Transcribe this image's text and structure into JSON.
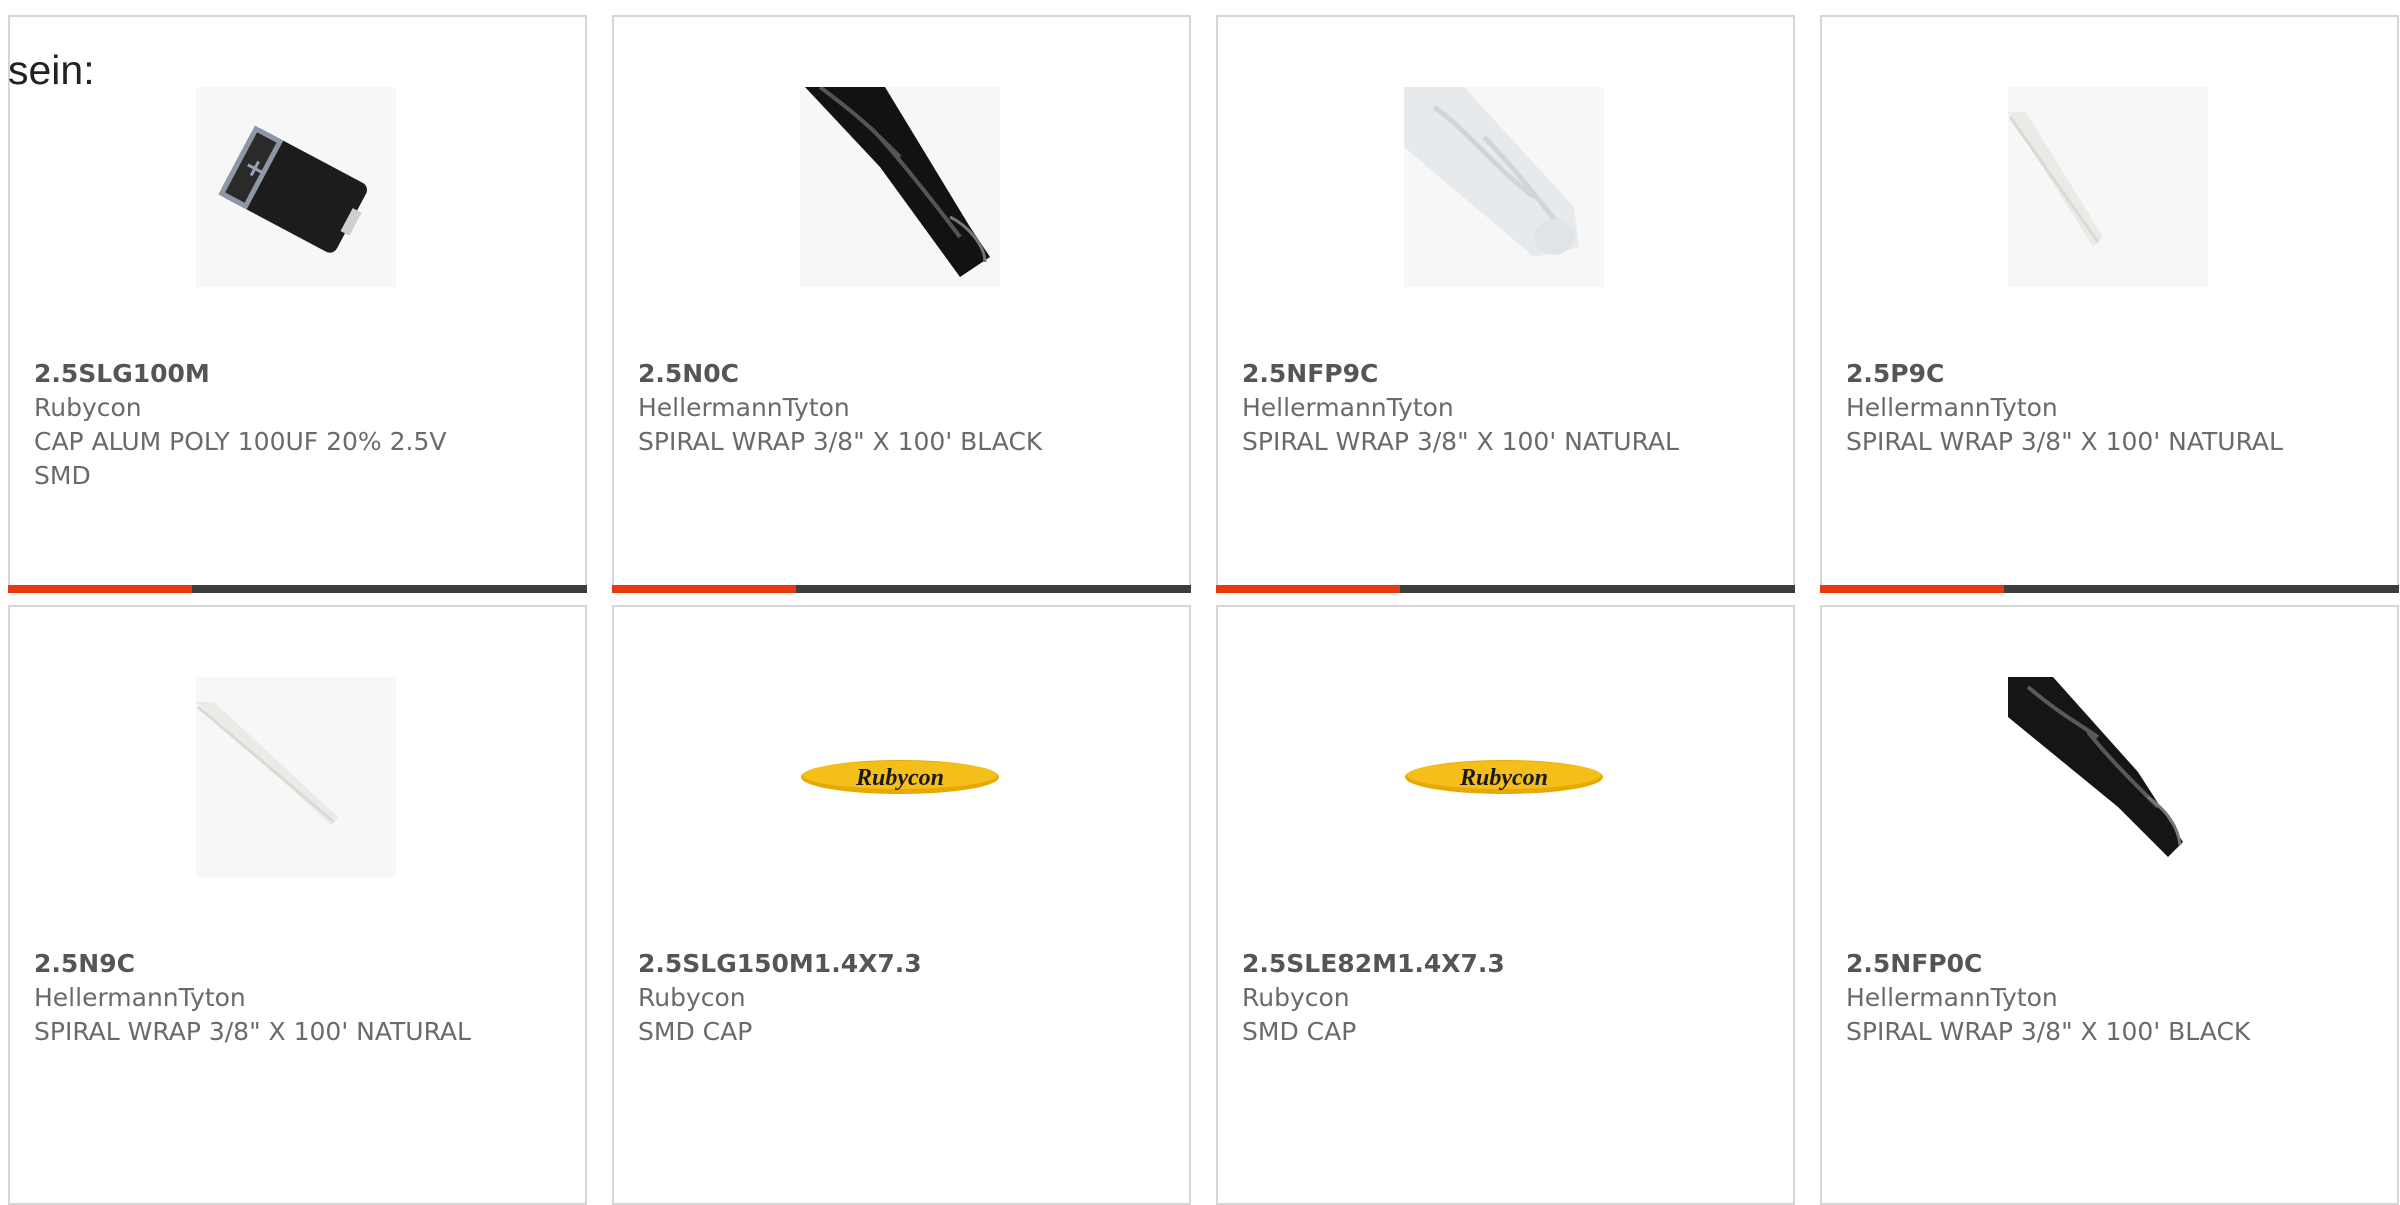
{
  "intro_text": "sein:",
  "products": [
    {
      "part": "2.5SLG100M",
      "manufacturer": "Rubycon",
      "description": "CAP ALUM POLY 100UF 20% 2.5V SMD",
      "image": "smd-capacitor-image"
    },
    {
      "part": "2.5N0C",
      "manufacturer": "HellermannTyton",
      "description": "SPIRAL WRAP 3/8\" X 100' BLACK",
      "image": "black-spiral-wrap-image"
    },
    {
      "part": "2.5NFP9C",
      "manufacturer": "HellermannTyton",
      "description": "SPIRAL WRAP 3/8\" X 100' NATURAL",
      "image": "natural-spiral-wrap-image"
    },
    {
      "part": "2.5P9C",
      "manufacturer": "HellermannTyton",
      "description": "SPIRAL WRAP 3/8\" X 100' NATURAL",
      "image": "natural-tube-image"
    },
    {
      "part": "2.5N9C",
      "manufacturer": "HellermannTyton",
      "description": "SPIRAL WRAP 3/8\" X 100' NATURAL",
      "image": "natural-tube-image"
    },
    {
      "part": "2.5SLG150M1.4X7.3",
      "manufacturer": "Rubycon",
      "description": "SMD CAP",
      "image": "rubycon-logo",
      "logo_text": "Rubycon"
    },
    {
      "part": "2.5SLE82M1.4X7.3",
      "manufacturer": "Rubycon",
      "description": "SMD CAP",
      "image": "rubycon-logo",
      "logo_text": "Rubycon"
    },
    {
      "part": "2.5NFP0C",
      "manufacturer": "HellermannTyton",
      "description": "SPIRAL WRAP 3/8\" X 100' BLACK",
      "image": "black-spiral-wrap-image"
    }
  ],
  "colors": {
    "accent": "#e8380d",
    "bar": "#3d3d3d",
    "border": "#d6d6d6",
    "logo_yellow": "#f2b705"
  }
}
